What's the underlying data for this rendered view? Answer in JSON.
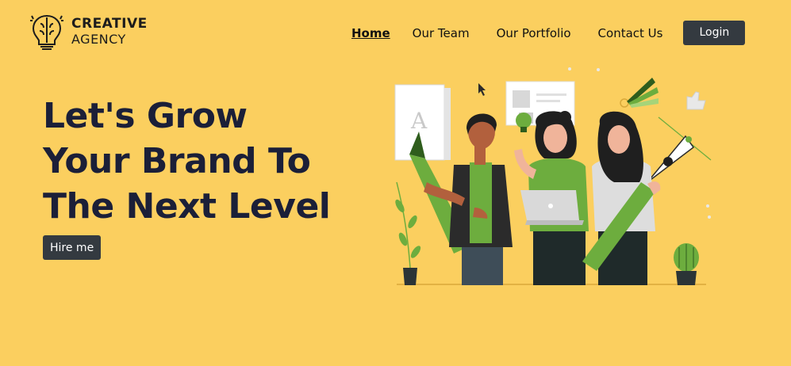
{
  "brand": {
    "line1": "CREATIVE",
    "line2": "AGENCY",
    "icon": "brain-lightbulb-icon"
  },
  "nav": {
    "items": [
      {
        "label": "Home",
        "active": true
      },
      {
        "label": "Our Team",
        "active": false
      },
      {
        "label": "Our Portfolio",
        "active": false
      },
      {
        "label": "Contact Us",
        "active": false
      }
    ],
    "login_label": "Login"
  },
  "hero": {
    "title_lines": [
      "Let's Grow",
      "Your Brand To",
      "The Next Level"
    ],
    "cta_label": "Hire me",
    "illustration_letter": "A"
  },
  "colors": {
    "background": "#fbcf5f",
    "button": "#343a40",
    "title": "#1b1f38",
    "accent_green": "#6dad3e"
  }
}
